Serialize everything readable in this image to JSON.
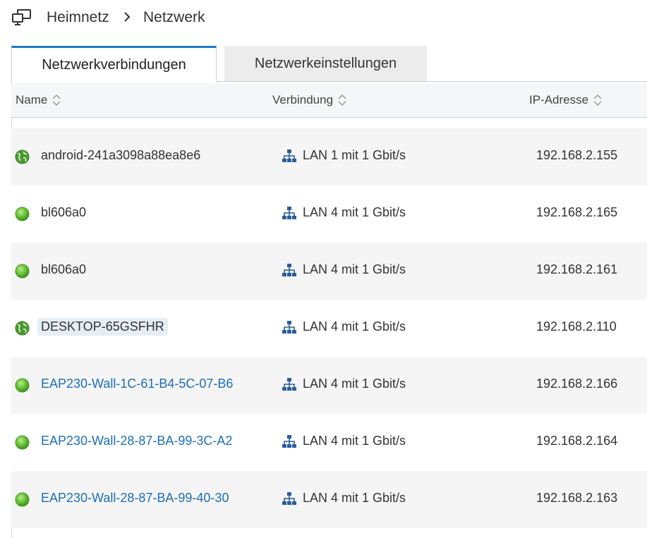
{
  "breadcrumb": {
    "home": "Heimnetz",
    "current": "Netzwerk"
  },
  "tabs": [
    {
      "label": "Netzwerkverbindungen",
      "active": true
    },
    {
      "label": "Netzwerkeinstellungen",
      "active": false
    }
  ],
  "table": {
    "columns": {
      "name": "Name",
      "connection": "Verbindung",
      "ip": "IP-Adresse"
    },
    "rows": [
      {
        "name": "android-241a3098a88ea8e6",
        "status": "globe-icon",
        "connection": "LAN 1 mit 1 Gbit/s",
        "ip": "192.168.2.155"
      },
      {
        "name": "bl606a0",
        "status": "green-dot-icon",
        "connection": "LAN 4 mit 1 Gbit/s",
        "ip": "192.168.2.165"
      },
      {
        "name": "bl606a0",
        "status": "green-dot-icon",
        "connection": "LAN 4 mit 1 Gbit/s",
        "ip": "192.168.2.161"
      },
      {
        "name": "DESKTOP-65GSFHR",
        "status": "globe-icon",
        "connection": "LAN 4 mit 1 Gbit/s",
        "ip": "192.168.2.110"
      },
      {
        "name": "EAP230-Wall-1C-61-B4-5C-07-B6",
        "status": "green-dot-icon",
        "connection": "LAN 4 mit 1 Gbit/s",
        "ip": "192.168.2.166"
      },
      {
        "name": "EAP230-Wall-28-87-BA-99-3C-A2",
        "status": "green-dot-icon",
        "connection": "LAN 4 mit 1 Gbit/s",
        "ip": "192.168.2.164"
      },
      {
        "name": "EAP230-Wall-28-87-BA-99-40-30",
        "status": "green-dot-icon",
        "connection": "LAN 4 mit 1 Gbit/s",
        "ip": "192.168.2.163"
      }
    ]
  },
  "colors": {
    "accent": "#1f78c8",
    "link": "#1c6fb8",
    "online_green": "#5cb82e",
    "lan_icon": "#2a5d9c"
  }
}
